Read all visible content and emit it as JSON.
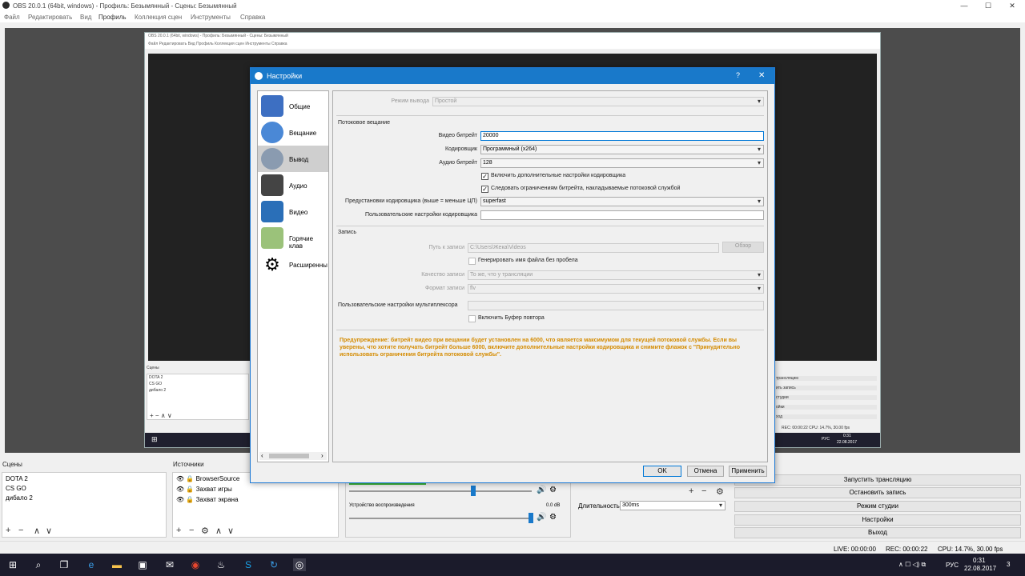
{
  "window": {
    "title": "OBS 20.0.1 (64bit, windows) - Профиль: Безымянный - Сцены: Безымянный",
    "minimize": "—",
    "maximize": "☐",
    "close": "✕"
  },
  "menu": [
    "Файл",
    "Редактировать",
    "Вид",
    "Профиль",
    "Коллекция сцен",
    "Инструменты",
    "Справка"
  ],
  "inner": {
    "title": "OBS 20.0.1 (64bit, windows) - Профиль: Безымянный - Сцены: Безымянный",
    "menu": "Файл   Редактировать   Вид   Профиль   Коллекция сцен   Инструменты   Справка",
    "scenes_header": "Сцены",
    "scenes": [
      "DOTA 2",
      "CS GO",
      "дибало 2"
    ],
    "controls": [
      "трансляцию",
      "ить запись",
      "студии",
      "ойки",
      "ход"
    ],
    "status": "REC: 00:00:22   CPU: 14.7%, 30.00 fps",
    "tray": "РУС",
    "time": "0:31",
    "date": "22.08.2017"
  },
  "docks": {
    "scenes_header": "Сцены",
    "scenes": [
      "DOTA 2",
      "CS GO",
      "дибало 2"
    ],
    "sources_header": "Источники",
    "sources": [
      "BrowserSource",
      "Захват игры",
      "Захват экрана"
    ],
    "mixer_device": "Устройство воспроизведения",
    "mixer_db": "0.0 dB",
    "duration_label": "Длительность",
    "duration_value": "300ms"
  },
  "controls": [
    "Запустить трансляцию",
    "Остановить запись",
    "Режим студии",
    "Настройки",
    "Выход"
  ],
  "status": {
    "live": "LIVE: 00:00:00",
    "rec": "REC: 00:00:22",
    "cpu": "CPU: 14.7%, 30.00 fps"
  },
  "taskbar": {
    "lang": "РУС",
    "time": "0:31",
    "date": "22.08.2017",
    "notif": "3"
  },
  "dialog": {
    "title": "Настройки",
    "help": "?",
    "close": "✕",
    "sidebar": [
      "Общие",
      "Вещание",
      "Вывод",
      "Аудио",
      "Видео",
      "Горячие клав",
      "Расширенны"
    ],
    "output_mode_label": "Режим вывода",
    "output_mode_value": "Простой",
    "streaming_section": "Потоковое вещание",
    "video_bitrate_label": "Видео битрейт",
    "video_bitrate_value": "20000",
    "encoder_label": "Кодировщик",
    "encoder_value": "Программный (x264)",
    "audio_bitrate_label": "Аудио битрейт",
    "audio_bitrate_value": "128",
    "adv_encoder_check": "Включить дополнительные настройки кодировщика",
    "enforce_limits_check": "Следовать ограничениям битрейта, накладываемые потоковой службой",
    "preset_label": "Предустановки кодировщика (выше = меньше ЦП)",
    "preset_value": "superfast",
    "custom_encoder_label": "Пользовательские настройки кодировщика",
    "custom_encoder_value": "",
    "recording_section": "Запись",
    "rec_path_label": "Путь к записи",
    "rec_path_value": "C:\\Users\\Жека\\Videos",
    "browse_button": "Обзор",
    "no_space_check": "Генерировать имя файла без пробела",
    "rec_quality_label": "Качество записи",
    "rec_quality_value": "То же, что у трансляции",
    "rec_format_label": "Формат записи",
    "rec_format_value": "flv",
    "muxer_label": "Пользовательские настройки мультиплексора",
    "muxer_value": "",
    "replay_check": "Включить Буфер повтора",
    "warning": "Предупреждение: битрейт видео при вещании будет установлен на 6000, что является максимумом для текущей потоковой службы. Если вы уверены, что хотите получать битрейт больше 6000, включите дополнительные настройки кодировщика и снимите флажок с \"Принудительно использовать ограничения битрейта потоковой службы\".",
    "ok": "OK",
    "cancel": "Отмена",
    "apply": "Применить"
  },
  "colors": {
    "accent": "#1979ca",
    "warning": "#d48b00",
    "taskbar": "#1b1b2b"
  }
}
